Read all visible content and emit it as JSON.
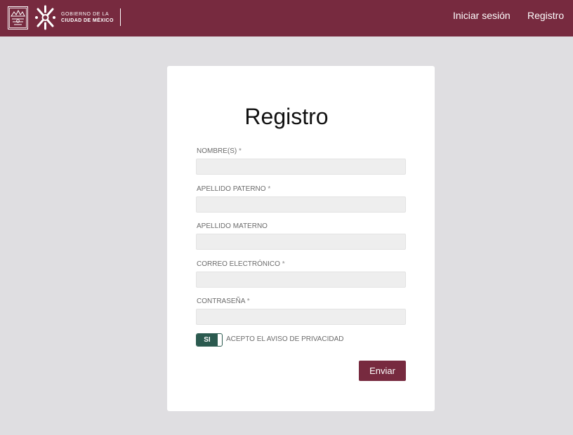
{
  "header": {
    "brand_line1": "GOBIERNO DE LA",
    "brand_line2": "CIUDAD DE MÉXICO",
    "nav": {
      "login": "Iniciar sesión",
      "register": "Registro"
    }
  },
  "form": {
    "title": "Registro",
    "required_marker": "*",
    "fields": [
      {
        "label": "NOMBRE(S)",
        "required": true,
        "value": "",
        "placeholder": ""
      },
      {
        "label": "APELLIDO PATERNO",
        "required": true,
        "value": "",
        "placeholder": ""
      },
      {
        "label": "APELLIDO MATERNO",
        "required": false,
        "value": "",
        "placeholder": ""
      },
      {
        "label": "CORREO ELECTRÓNICO",
        "required": true,
        "value": "",
        "placeholder": ""
      },
      {
        "label": "CONTRASEÑA",
        "required": true,
        "value": "",
        "placeholder": ""
      }
    ],
    "privacy_toggle": {
      "state_label": "SI",
      "label": "ACEPTO EL AVISO DE PRIVACIDAD"
    },
    "submit_label": "Enviar"
  },
  "colors": {
    "header_bg": "#772a3f",
    "page_bg": "#dfdee1",
    "toggle_on": "#2b5a4f",
    "button_bg": "#772a3f"
  }
}
